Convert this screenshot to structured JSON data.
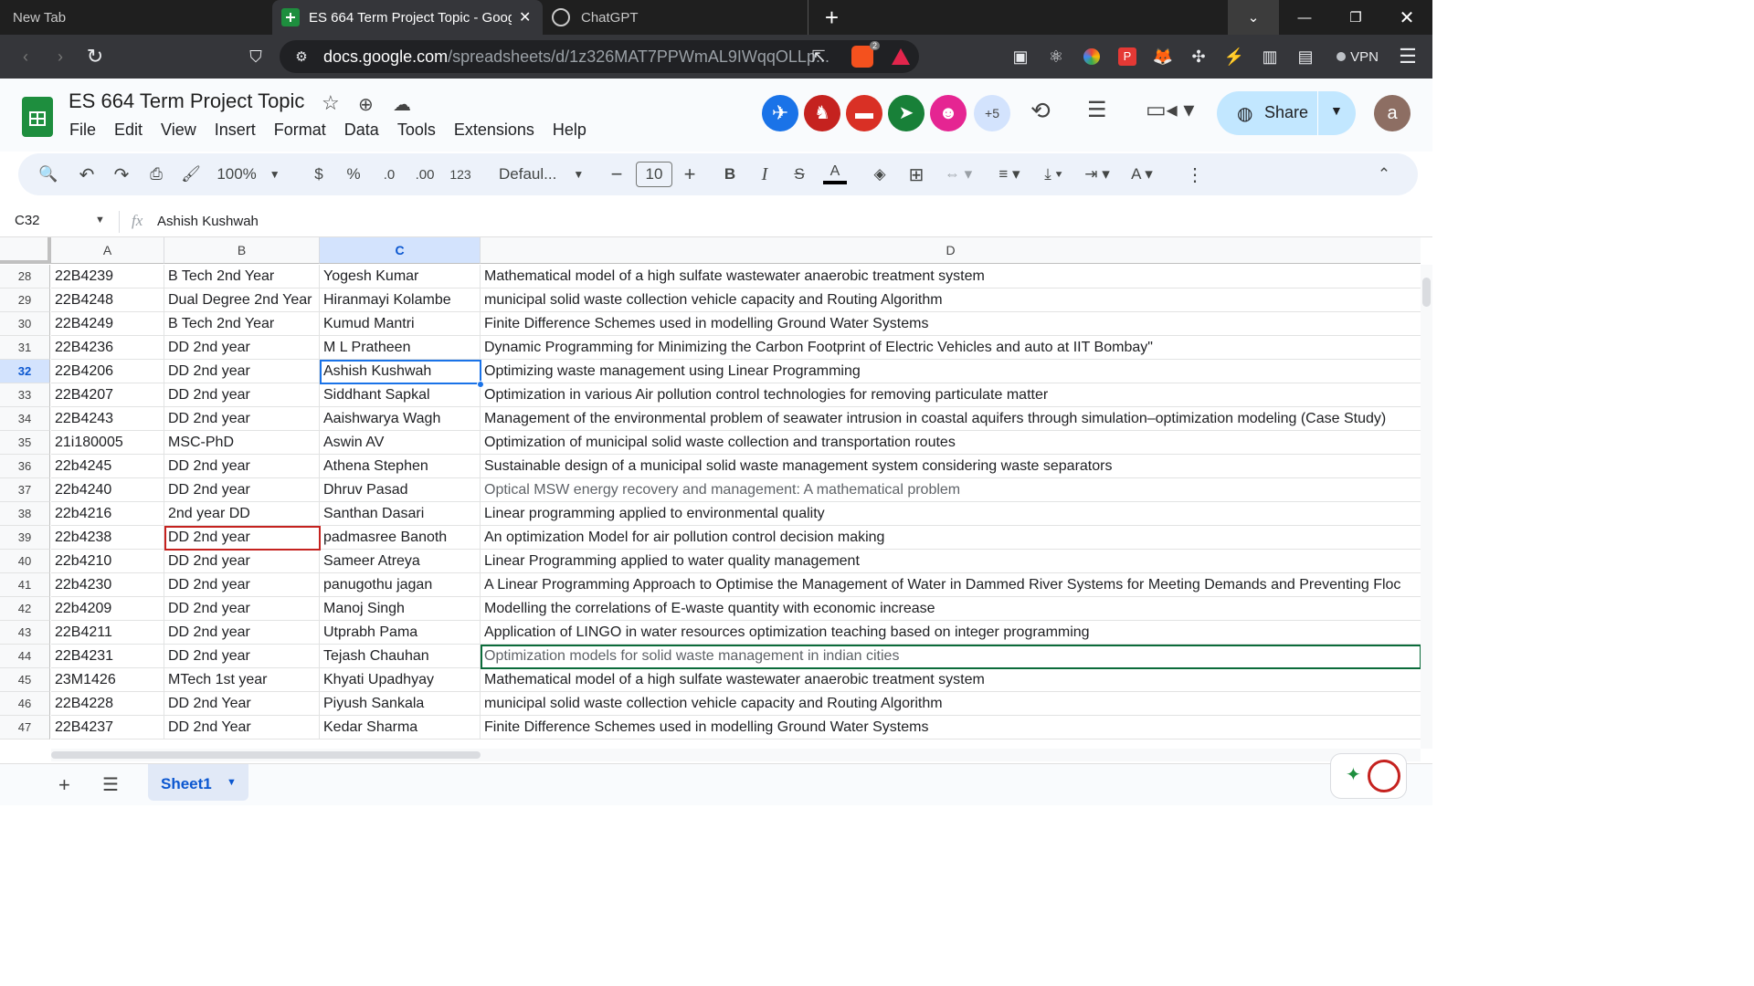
{
  "browser": {
    "tabs": [
      {
        "title": "New Tab"
      },
      {
        "title": "ES 664 Term Project Topic - Googl"
      },
      {
        "title": "ChatGPT"
      }
    ],
    "new_tab_symbol": "+",
    "url_domain": "docs.google.com",
    "url_path": "/spreadsheets/d/1z326MAT7PPWmAL9IWqqOLLp...",
    "brave_badge": "2",
    "vpn_label": "VPN"
  },
  "app": {
    "doc_title": "ES 664 Term Project Topic",
    "menu": [
      "File",
      "Edit",
      "View",
      "Insert",
      "Format",
      "Data",
      "Tools",
      "Extensions",
      "Help"
    ],
    "collaborators_more": "+5",
    "share_label": "Share",
    "account_initial": "a"
  },
  "toolbar": {
    "zoom": "100%",
    "currency": "$",
    "percent": "%",
    "dec_decrease": ".0",
    "dec_increase": ".00",
    "number_format": "123",
    "font": "Defaul...",
    "font_size": "10"
  },
  "formula_bar": {
    "cell_ref": "C32",
    "fx": "fx",
    "value": "Ashish Kushwah"
  },
  "columns": [
    "A",
    "B",
    "C",
    "D"
  ],
  "rows": [
    {
      "n": "28",
      "a": "22B4239",
      "b": "B Tech 2nd Year",
      "c": "Yogesh Kumar",
      "d": "Mathematical model  of a high sulfate wastewater anaerobic treatment system"
    },
    {
      "n": "29",
      "a": "22B4248",
      "b": "Dual Degree 2nd Year",
      "c": "Hiranmayi Kolambe",
      "d": "municipal solid waste collection vehicle capacity and Routing Algorithm"
    },
    {
      "n": "30",
      "a": "22B4249",
      "b": "B Tech 2nd Year",
      "c": "Kumud Mantri",
      "d": "Finite Difference Schemes used in modelling Ground Water Systems"
    },
    {
      "n": "31",
      "a": "22B4236",
      "b": "DD 2nd year",
      "c": "M L Pratheen",
      "d": "Dynamic Programming for Minimizing the Carbon Footprint of Electric Vehicles and auto at IIT Bombay\""
    },
    {
      "n": "32",
      "a": "22B4206",
      "b": "DD 2nd year",
      "c": "Ashish Kushwah",
      "d": "Optimizing waste management using Linear Programming"
    },
    {
      "n": "33",
      "a": "22B4207",
      "b": "DD 2nd year",
      "c": "Siddhant Sapkal",
      "d": "Optimization in various Air pollution control technologies for removing particulate matter"
    },
    {
      "n": "34",
      "a": "22B4243",
      "b": "DD 2nd year",
      "c": "Aaishwarya Wagh",
      "d": "Management of the environmental problem of seawater intrusion in coastal aquifers through simulation–optimization modeling (Case Study)"
    },
    {
      "n": "35",
      "a": "21i180005",
      "b": "MSC-PhD",
      "c": "Aswin AV",
      "d": "Optimization of municipal solid waste collection and transportation routes"
    },
    {
      "n": "36",
      "a": "22b4245",
      "b": "DD 2nd year",
      "c": "Athena Stephen",
      "d": "Sustainable design of a municipal solid waste management system considering waste separators"
    },
    {
      "n": "37",
      "a": "22b4240",
      "b": "DD 2nd year",
      "c": "Dhruv Pasad",
      "d": "Optical MSW energy recovery and management: A mathematical problem"
    },
    {
      "n": "38",
      "a": "22b4216",
      "b": "2nd year DD",
      "c": "Santhan Dasari",
      "d": "Linear programming applied to environmental quality"
    },
    {
      "n": "39",
      "a": "22b4238",
      "b": "DD 2nd year",
      "c": "padmasree Banoth",
      "d": "An optimization Model for air pollution control decision making"
    },
    {
      "n": "40",
      "a": "22b4210",
      "b": "DD 2nd year",
      "c": "Sameer Atreya",
      "d": "Linear Programming applied to water quality management"
    },
    {
      "n": "41",
      "a": "22b4230",
      "b": "DD 2nd year",
      "c": "panugothu jagan",
      "d": "A Linear Programming Approach to Optimise the Management of Water in Dammed River Systems for Meeting Demands and Preventing Floc"
    },
    {
      "n": "42",
      "a": "22b4209",
      "b": "DD 2nd year",
      "c": "Manoj Singh",
      "d": "Modelling the correlations of E-waste quantity with economic increase"
    },
    {
      "n": "43",
      "a": "22B4211",
      "b": "DD 2nd year",
      "c": "Utprabh Pama",
      "d": "Application of LINGO in water resources optimization teaching based on integer programming"
    },
    {
      "n": "44",
      "a": "22B4231",
      "b": "DD 2nd year",
      "c": "Tejash Chauhan",
      "d": "Optimization models for solid waste management in indian cities"
    },
    {
      "n": "45",
      "a": "23M1426",
      "b": "MTech 1st year",
      "c": "Khyati Upadhyay",
      "d": "Mathematical model  of a high sulfate wastewater anaerobic treatment system"
    },
    {
      "n": "46",
      "a": "22B4228",
      "b": "DD 2nd Year",
      "c": "Piyush Sankala",
      "d": "municipal solid waste collection vehicle capacity and Routing Algorithm"
    },
    {
      "n": "47",
      "a": "22B4237",
      "b": "DD 2nd Year",
      "c": "Kedar Sharma",
      "d": "Finite Difference Schemes used in modelling Ground Water Systems"
    }
  ],
  "sheet_tab": "Sheet1",
  "colors": {
    "selected": "#1a73e8",
    "collab_red": "#c5221f",
    "collab2_green": "#0b6b3a"
  }
}
